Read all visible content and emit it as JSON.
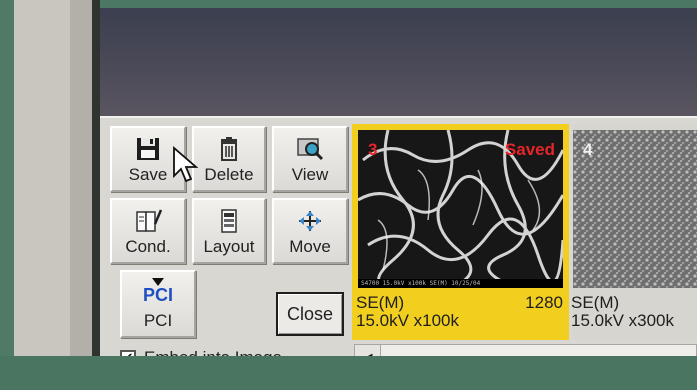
{
  "toolbar": {
    "save_label": "Save",
    "delete_label": "Delete",
    "view_label": "View",
    "cond_label": "Cond.",
    "layout_label": "Layout",
    "move_label": "Move",
    "pci_icon_text": "PCI",
    "pci_label": "PCI",
    "close_label": "Close",
    "embed_label": "Embed into Image",
    "embed_checked": true
  },
  "thumbnails": [
    {
      "number": "3",
      "status": "Saved",
      "mode": "SE(M)",
      "count": "1280",
      "settings": "15.0kV x100k",
      "caption": "S4700 15.0kV x100k SE(M) 10/25/04",
      "selected": true,
      "border_color": "#f2cf1f"
    },
    {
      "number": "4",
      "mode": "SE(M)",
      "settings": "15.0kV x300k",
      "selected": false
    }
  ],
  "colors": {
    "selection": "#f2cf1f",
    "overlay_text": "#e4262a",
    "panel_bg": "#d9d7d2"
  },
  "icons": [
    "floppy-disk-icon",
    "trash-icon",
    "magnifier-icon",
    "notebook-pen-icon",
    "layout-icon",
    "move-arrows-icon",
    "pci-icon",
    "checkmark-icon",
    "arrow-left-icon",
    "mouse-pointer-icon"
  ]
}
